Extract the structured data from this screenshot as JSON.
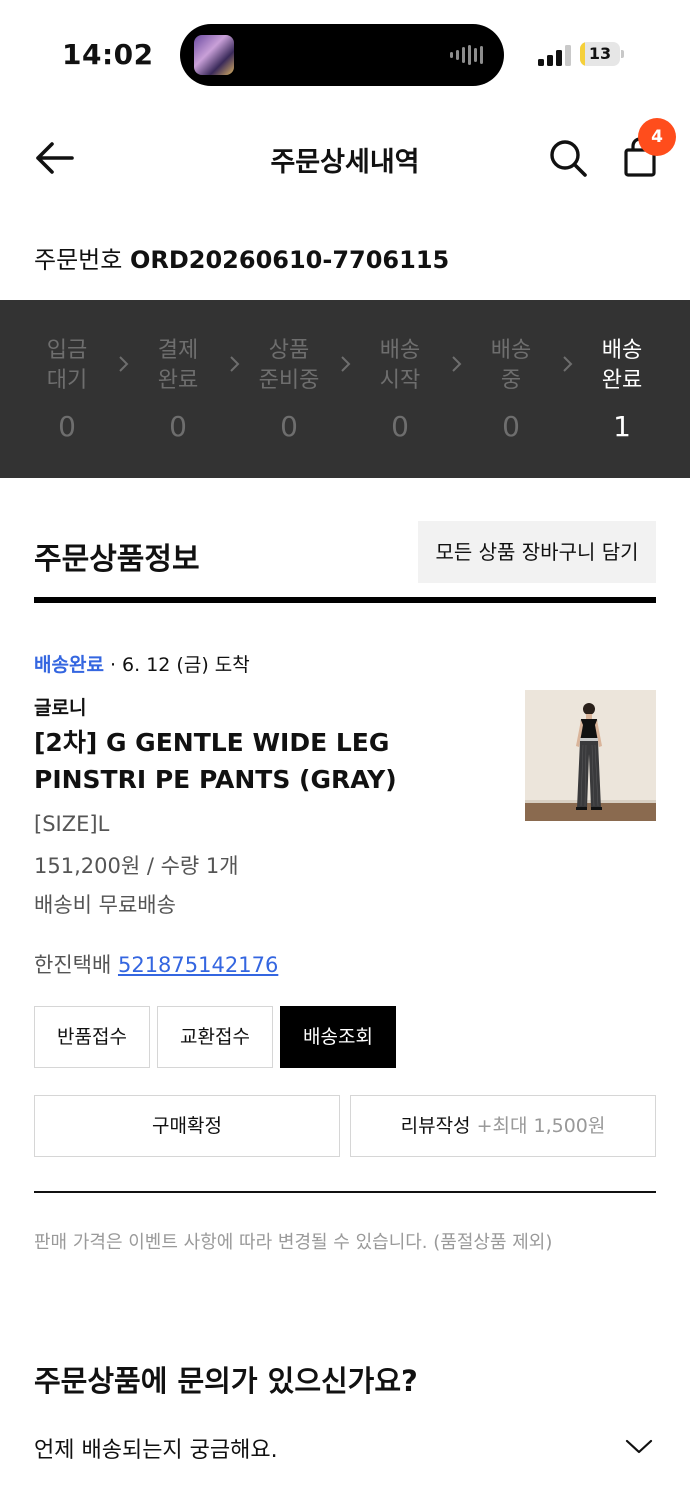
{
  "status_bar": {
    "time": "14:02",
    "battery": "13",
    "battery_level": 0.13
  },
  "header": {
    "title": "주문상세내역",
    "cart_count": "4"
  },
  "order": {
    "label": "주문번호",
    "number": "ORD20260610-7706115"
  },
  "stages": [
    {
      "label": "입금\n대기",
      "count": "0",
      "active": false
    },
    {
      "label": "결제\n완료",
      "count": "0",
      "active": false
    },
    {
      "label": "상품\n준비중",
      "count": "0",
      "active": false
    },
    {
      "label": "배송\n시작",
      "count": "0",
      "active": false
    },
    {
      "label": "배송\n중",
      "count": "0",
      "active": false
    },
    {
      "label": "배송\n완료",
      "count": "1",
      "active": true
    }
  ],
  "section": {
    "title": "주문상품정보",
    "cart_all_button": "모든 상품 장바구니 담기"
  },
  "product": {
    "delivery_status": "배송완료",
    "delivery_date": " · 6. 12 (금) 도착",
    "brand": "글로니",
    "name": "[2차] G GENTLE WIDE LEG PINSTRI PE PANTS (GRAY)",
    "size": "[SIZE]L",
    "price_qty": "151,200원 / 수량 1개",
    "shipping": "배송비 무료배송"
  },
  "shipment": {
    "courier": "한진택배",
    "tracking_number": "521875142176"
  },
  "actions": {
    "return": "반품접수",
    "exchange": "교환접수",
    "track": "배송조회",
    "confirm": "구매확정",
    "review": "리뷰작성",
    "review_bonus": "+최대 1,500원"
  },
  "notice": "판매 가격은 이벤트 사항에 따라 변경될 수 있습니다. (품절상품 제외)",
  "faq": {
    "title": "주문상품에 문의가 있으신가요?",
    "question": "언제 배송되는지 궁금해요."
  }
}
